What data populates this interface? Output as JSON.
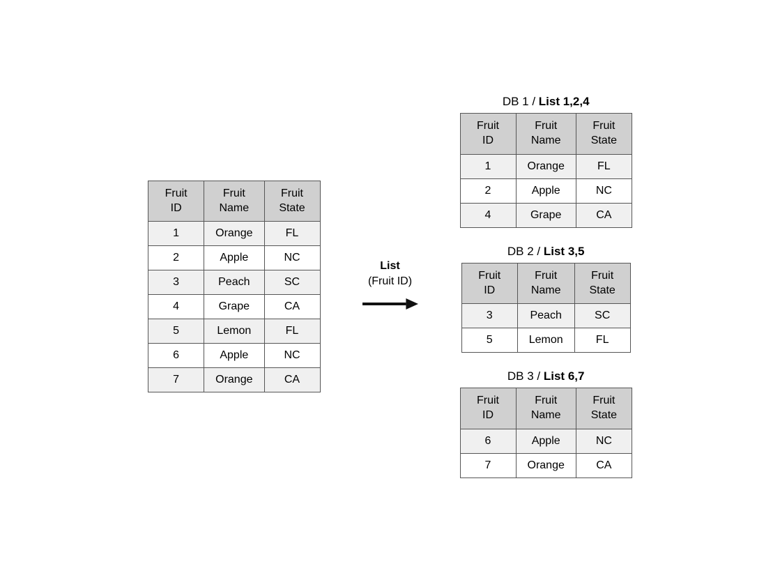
{
  "mainTable": {
    "title": null,
    "headers": [
      "Fruit\nID",
      "Fruit\nName",
      "Fruit\nState"
    ],
    "rows": [
      {
        "id": "1",
        "name": "Orange",
        "state": "FL"
      },
      {
        "id": "2",
        "name": "Apple",
        "state": "NC"
      },
      {
        "id": "3",
        "name": "Peach",
        "state": "SC"
      },
      {
        "id": "4",
        "name": "Grape",
        "state": "CA"
      },
      {
        "id": "5",
        "name": "Lemon",
        "state": "FL"
      },
      {
        "id": "6",
        "name": "Apple",
        "state": "NC"
      },
      {
        "id": "7",
        "name": "Orange",
        "state": "CA"
      }
    ]
  },
  "arrow": {
    "label_line1": "List",
    "label_line2": "(Fruit ID)"
  },
  "databases": [
    {
      "title_normal": "DB 1 / ",
      "title_bold": "List 1,2,4",
      "headers": [
        "Fruit\nID",
        "Fruit\nName",
        "Fruit\nState"
      ],
      "rows": [
        {
          "id": "1",
          "name": "Orange",
          "state": "FL"
        },
        {
          "id": "2",
          "name": "Apple",
          "state": "NC"
        },
        {
          "id": "4",
          "name": "Grape",
          "state": "CA"
        }
      ]
    },
    {
      "title_normal": "DB 2 / ",
      "title_bold": "List 3,5",
      "headers": [
        "Fruit\nID",
        "Fruit\nName",
        "Fruit\nState"
      ],
      "rows": [
        {
          "id": "3",
          "name": "Peach",
          "state": "SC"
        },
        {
          "id": "5",
          "name": "Lemon",
          "state": "FL"
        }
      ]
    },
    {
      "title_normal": "DB 3 / ",
      "title_bold": "List 6,7",
      "headers": [
        "Fruit\nID",
        "Fruit\nName",
        "Fruit\nState"
      ],
      "rows": [
        {
          "id": "6",
          "name": "Apple",
          "state": "NC"
        },
        {
          "id": "7",
          "name": "Orange",
          "state": "CA"
        }
      ]
    }
  ]
}
